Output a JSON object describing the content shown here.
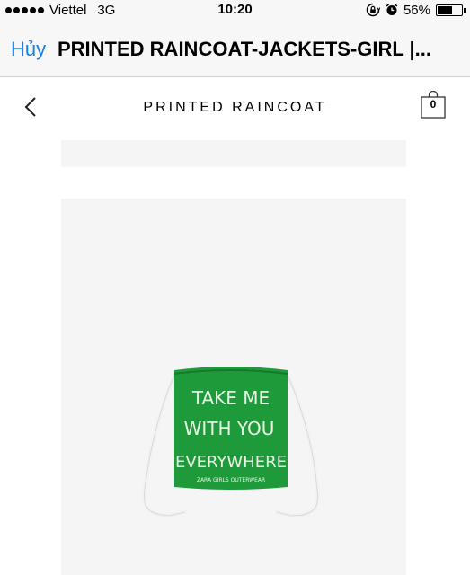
{
  "status_bar": {
    "carrier": "Viettel",
    "network": "3G",
    "time": "10:20",
    "battery": "56%",
    "battery_level": 0.56
  },
  "nav_bar": {
    "cancel_label": "Hủy",
    "title": "PRINTED RAINCOAT-JACKETS-GIRL |..."
  },
  "header": {
    "product_title": "PRINTED RAINCOAT",
    "cart_count": "0"
  },
  "product_image": {
    "bag_color": "#1f9a3a",
    "print_lines": [
      "TAKE ME",
      "WITH YOU",
      "EVERYWHERE"
    ],
    "print_footer": "ZARA GIRLS OUTERWEAR"
  },
  "icons": [
    "signal-icon",
    "rotation-lock-icon",
    "alarm-icon",
    "battery-icon",
    "back-chevron-icon",
    "shopping-bag-icon"
  ]
}
